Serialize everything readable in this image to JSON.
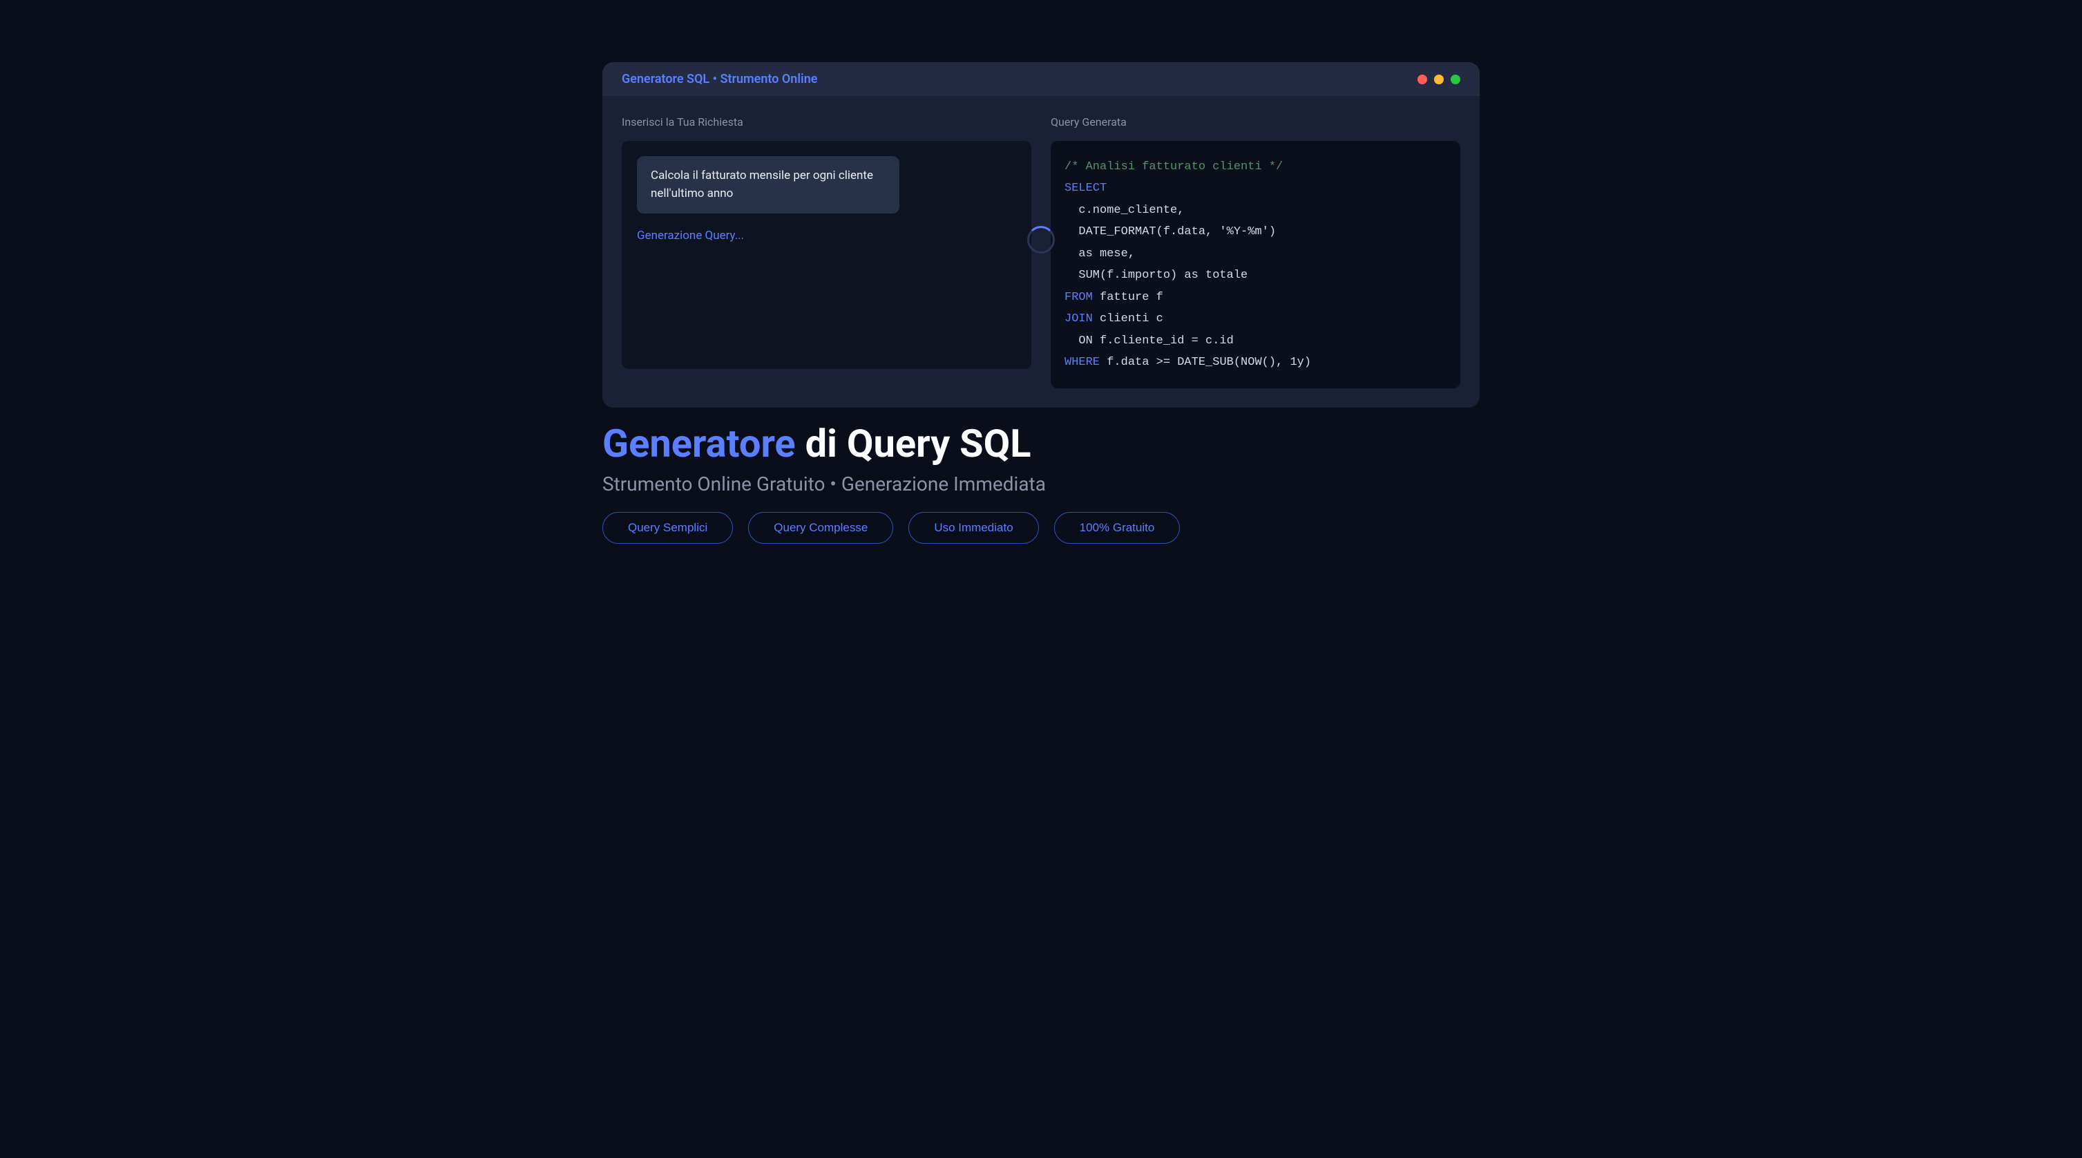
{
  "window": {
    "title": "Generatore SQL • Strumento Online",
    "input_label": "Inserisci la Tua Richiesta",
    "output_label": "Query Generata",
    "user_request": "Calcola il fatturato mensile per ogni cliente nell'ultimo anno",
    "generating_text": "Generazione Query..."
  },
  "code": {
    "comment": "/* Analisi fatturato clienti */",
    "kw_select": "SELECT",
    "line_col1": "  c.nome_cliente,",
    "line_col2": "  DATE_FORMAT(f.data, '%Y-%m')",
    "line_col3": "  as mese,",
    "line_col4": "  SUM(f.importo) as totale",
    "kw_from": "FROM",
    "from_rest": " fatture f",
    "kw_join": "JOIN",
    "join_rest": " clienti c",
    "line_on": "  ON f.cliente_id = c.id",
    "kw_where": "WHERE",
    "where_rest": " f.data >= DATE_SUB(NOW(), 1y)"
  },
  "hero": {
    "title_accent": "Generatore",
    "title_rest": " di Query SQL",
    "subtitle": "Strumento Online Gratuito • Generazione Immediata"
  },
  "pills": [
    "Query Semplici",
    "Query Complesse",
    "Uso Immediato",
    "100% Gratuito"
  ]
}
